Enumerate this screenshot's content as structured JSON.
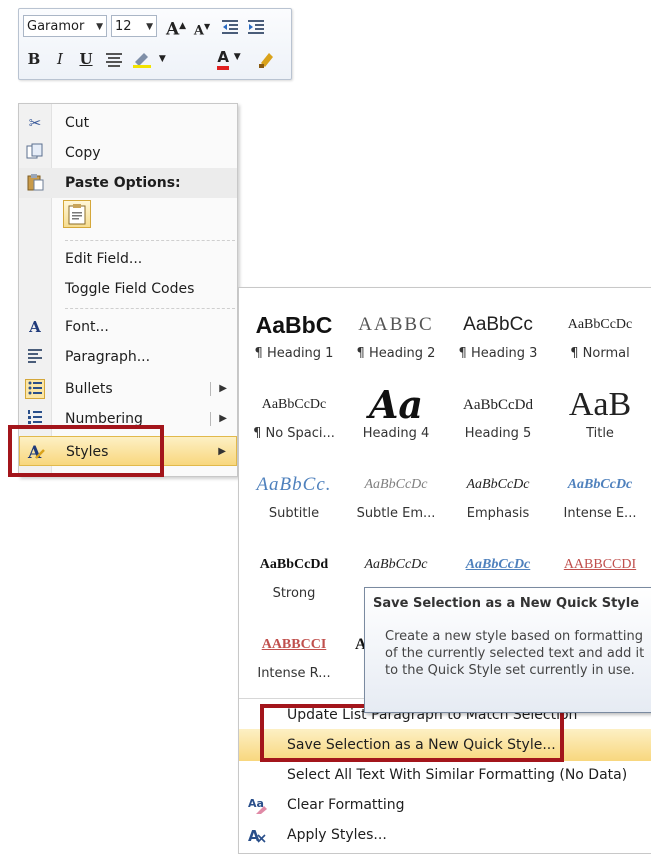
{
  "mini_toolbar": {
    "font_name": "Garamor",
    "font_size": "12",
    "grow_font": "A",
    "shrink_font": "A",
    "bold": "B",
    "italic": "I",
    "underline": "U",
    "font_color": "A"
  },
  "context_menu": {
    "items": [
      {
        "label": "Cut",
        "icon": "scissors-icon"
      },
      {
        "label": "Copy",
        "icon": "copy-icon"
      },
      {
        "label": "Paste Options:",
        "icon": "paste-icon"
      },
      {
        "label": "Edit Field...",
        "icon": ""
      },
      {
        "label": "Toggle Field Codes",
        "icon": ""
      },
      {
        "label": "Font...",
        "icon": "font-icon"
      },
      {
        "label": "Paragraph...",
        "icon": "paragraph-icon"
      },
      {
        "label": "Bullets",
        "icon": "bullets-icon"
      },
      {
        "label": "Numbering",
        "icon": "numbering-icon"
      },
      {
        "label": "Styles",
        "icon": "styles-icon"
      }
    ]
  },
  "style_gallery": {
    "styles": [
      {
        "preview": "AaBbC",
        "name": "¶ Heading 1"
      },
      {
        "preview": "AABBC",
        "name": "¶ Heading 2"
      },
      {
        "preview": "AaBbCc",
        "name": "¶ Heading 3"
      },
      {
        "preview": "AaBbCcDc",
        "name": "¶ Normal"
      },
      {
        "preview": "AaBbCcDc",
        "name": "¶ No Spaci..."
      },
      {
        "preview": "Aa",
        "name": "Heading 4"
      },
      {
        "preview": "AaBbCcDd",
        "name": "Heading 5"
      },
      {
        "preview": "AaB",
        "name": "Title"
      },
      {
        "preview": "AaBbCc.",
        "name": "Subtitle"
      },
      {
        "preview": "AaBbCcDc",
        "name": "Subtle Em..."
      },
      {
        "preview": "AaBbCcDc",
        "name": "Emphasis"
      },
      {
        "preview": "AaBbCcDc",
        "name": "Intense E..."
      },
      {
        "preview": "AaBbCcDd",
        "name": "Strong"
      },
      {
        "preview": "AaBbCcDc",
        "name": ""
      },
      {
        "preview": "AaBbCcDc",
        "name": ""
      },
      {
        "preview": "AABBCCDI",
        "name": ""
      },
      {
        "preview": "AABBCCI",
        "name": "Intense R..."
      },
      {
        "preview": "A",
        "name": ""
      }
    ],
    "commands": [
      {
        "label": "Update List Paragraph to Match Selection",
        "icon": ""
      },
      {
        "label": "Save Selection as a New Quick Style...",
        "icon": ""
      },
      {
        "label": "Select All Text With Similar Formatting (No Data)",
        "icon": ""
      },
      {
        "label": "Clear Formatting",
        "icon": "clear-formatting-icon"
      },
      {
        "label": "Apply Styles...",
        "icon": "apply-styles-icon"
      }
    ]
  },
  "tooltip": {
    "title": "Save Selection as a New Quick Style",
    "body": "Create a new style based on formatting of the currently selected text and add it to the Quick Style set currently in use."
  },
  "colors": {
    "highlight_border": "#a3151b",
    "hover_fill": "#f8d77e",
    "font_color_underline": "#e02020"
  }
}
